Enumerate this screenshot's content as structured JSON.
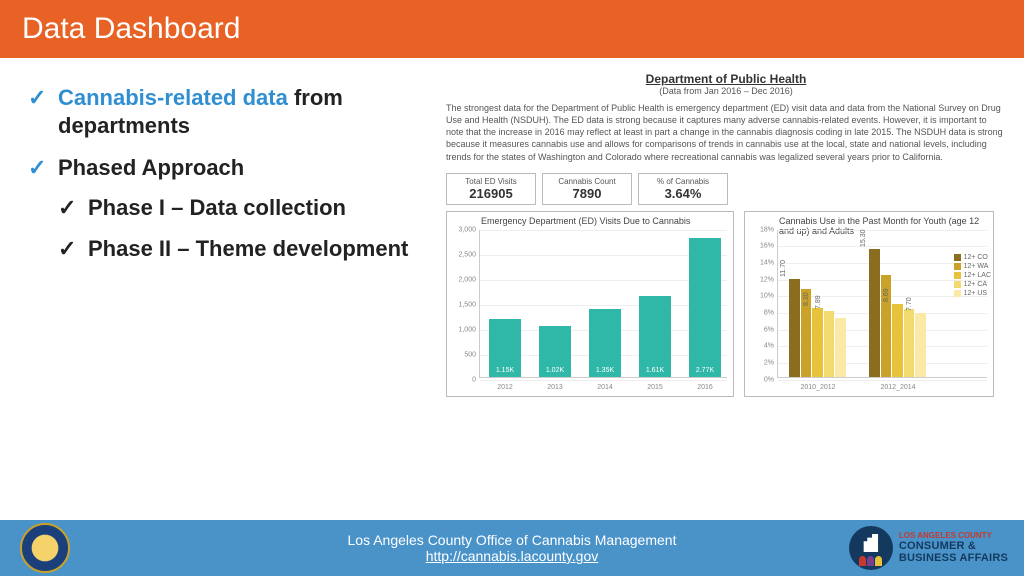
{
  "title": "Data Dashboard",
  "bullets": {
    "b1_hl": "Cannabis-related data",
    "b1_rest": " from departments",
    "b2": "Phased Approach",
    "b2a": "Phase I – Data collection",
    "b2b": "Phase II – Theme development"
  },
  "dph": {
    "title": "Department of Public Health",
    "subtitle": "(Data from Jan 2016 – Dec 2016)",
    "para": "The strongest data for the Department of Public Health is emergency department (ED) visit data and data from the National Survey on Drug Use and Health (NSDUH). The ED data is strong because it captures many adverse cannabis-related events. However, it is important to note that the increase in 2016 may reflect at least in part a change in the cannabis diagnosis coding in late 2015. The NSDUH data is strong because it measures cannabis use and allows for comparisons of trends in cannabis use at the local, state and national levels, including trends for the states of Washington and Colorado where recreational cannabis was legalized several years prior to California."
  },
  "stats": [
    {
      "label": "Total ED Visits",
      "value": "216905"
    },
    {
      "label": "Cannabis Count",
      "value": "7890"
    },
    {
      "label": "% of Cannabis",
      "value": "3.64%"
    }
  ],
  "chart_data": [
    {
      "type": "bar",
      "title": "Emergency Department (ED) Visits Due to Cannabis",
      "categories": [
        "2012",
        "2013",
        "2014",
        "2015",
        "2016"
      ],
      "values": [
        1150,
        1020,
        1350,
        1610,
        2770
      ],
      "value_labels": [
        "1.15K",
        "1.02K",
        "1.35K",
        "1.61K",
        "2.77K"
      ],
      "ylabel": "",
      "ylim": [
        0,
        3000
      ],
      "yticks": [
        0,
        500,
        1000,
        1500,
        2000,
        2500,
        3000
      ],
      "bar_color": "#2fb8a8"
    },
    {
      "type": "bar",
      "title": "Cannabis Use in the Past Month for Youth (age 12 and up) and Adults",
      "categories": [
        "2010_2012",
        "2012_2014"
      ],
      "series": [
        {
          "name": "12+ CO",
          "color": "#8a6d1f",
          "values": [
            11.7,
            15.3
          ]
        },
        {
          "name": "12+ WA",
          "color": "#c9a227",
          "values": [
            10.5,
            12.2
          ]
        },
        {
          "name": "12+ LAC",
          "color": "#e8c23a",
          "values": [
            8.3,
            8.69
          ]
        },
        {
          "name": "12+ CA",
          "color": "#f3da6e",
          "values": [
            7.89,
            8.1
          ]
        },
        {
          "name": "12+ US",
          "color": "#faeaa6",
          "values": [
            7.0,
            7.7
          ]
        }
      ],
      "visible_value_labels": {
        "0": {
          "12+ CO": "11.70",
          "12+ LAC": "8.30",
          "12+ CA": "7.89"
        },
        "1": {
          "12+ CO": "15.30",
          "12+ LAC": "8.69",
          "12+ US": "7.70"
        }
      },
      "ylim": [
        0,
        18
      ],
      "yticks": [
        0,
        2,
        4,
        6,
        8,
        10,
        12,
        14,
        16,
        18
      ],
      "ytick_labels": [
        "0%",
        "2%",
        "4%",
        "6%",
        "8%",
        "10%",
        "12%",
        "14%",
        "16%",
        "18%"
      ]
    }
  ],
  "footer": {
    "line1": "Los Angeles County Office of Cannabis Management",
    "link": "http://cannabis.lacounty.gov",
    "dcba_top": "LOS ANGELES COUNTY",
    "dcba_l1": "CONSUMER &",
    "dcba_l2": "BUSINESS AFFAIRS"
  }
}
